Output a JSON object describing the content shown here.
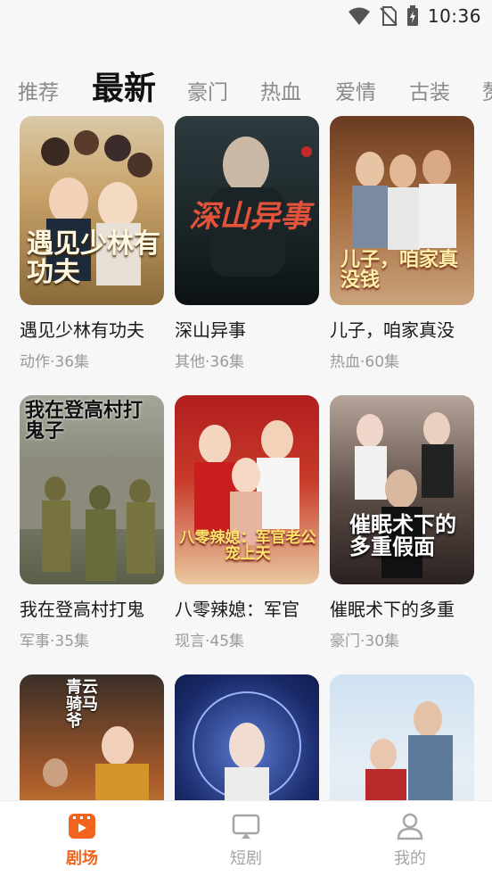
{
  "status": {
    "time": "10:36"
  },
  "tabs": [
    {
      "label": "推荐",
      "active": false
    },
    {
      "label": "最新",
      "active": true
    },
    {
      "label": "豪门",
      "active": false
    },
    {
      "label": "热血",
      "active": false
    },
    {
      "label": "爱情",
      "active": false
    },
    {
      "label": "古装",
      "active": false
    },
    {
      "label": "赘",
      "active": false
    }
  ],
  "cards": [
    {
      "title": "遇见少林有功夫",
      "meta": "动作·36集",
      "poster_text": "遇见少林有功夫"
    },
    {
      "title": "深山异事",
      "meta": "其他·36集",
      "poster_text": "深山异事"
    },
    {
      "title": "儿子，咱家真没",
      "meta": "热血·60集",
      "poster_text": "儿子，咱家真没钱"
    },
    {
      "title": "我在登高村打鬼",
      "meta": "军事·35集",
      "poster_text": "我在登高村打鬼子"
    },
    {
      "title": "八零辣媳：军官",
      "meta": "现言·45集",
      "poster_text": "八零辣媳：军官老公宠上天"
    },
    {
      "title": "催眠术下的多重",
      "meta": "豪门·30集",
      "poster_text": "催眠术下的多重假面"
    },
    {
      "title": "",
      "meta": "",
      "poster_text": "青云骑马爷"
    },
    {
      "title": "",
      "meta": "",
      "poster_text": ""
    },
    {
      "title": "",
      "meta": "",
      "poster_text": ""
    }
  ],
  "nav": [
    {
      "label": "剧场",
      "icon": "theater-icon",
      "active": true
    },
    {
      "label": "短剧",
      "icon": "tv-icon",
      "active": false
    },
    {
      "label": "我的",
      "icon": "profile-icon",
      "active": false
    }
  ],
  "colors": {
    "accent": "#f0641e",
    "inactive": "#a6a6a6"
  }
}
